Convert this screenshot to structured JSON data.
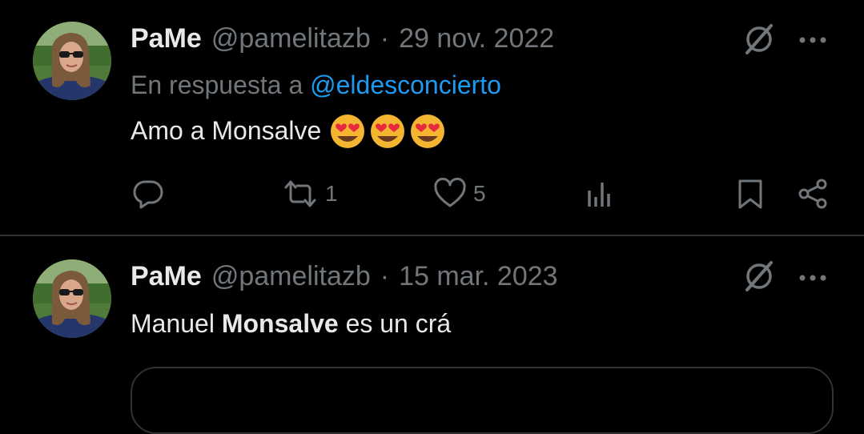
{
  "tweets": [
    {
      "name": "PaMe",
      "handle": "@pamelitazb",
      "separator": "·",
      "date": "29 nov. 2022",
      "reply_prefix": "En respuesta a",
      "reply_to": "@eldesconcierto",
      "text": "Amo a Monsalve",
      "emoji": [
        "heart-eyes-emoji",
        "heart-eyes-emoji",
        "heart-eyes-emoji"
      ],
      "retweets": "1",
      "likes": "5"
    },
    {
      "name": "PaMe",
      "handle": "@pamelitazb",
      "separator": "·",
      "date": "15 mar. 2023",
      "text_part1": "Manuel",
      "text_bold": "Monsalve",
      "text_part2": "es un crá"
    }
  ],
  "icons": [
    "grok-icon",
    "more-icon",
    "reply-icon",
    "retweet-icon",
    "like-icon",
    "views-icon",
    "bookmark-icon",
    "share-icon"
  ],
  "colors": {
    "background": "#000000",
    "text": "#e7e9ea",
    "secondary": "#71767b",
    "link": "#1d9bf0",
    "divider": "#2f3336"
  }
}
